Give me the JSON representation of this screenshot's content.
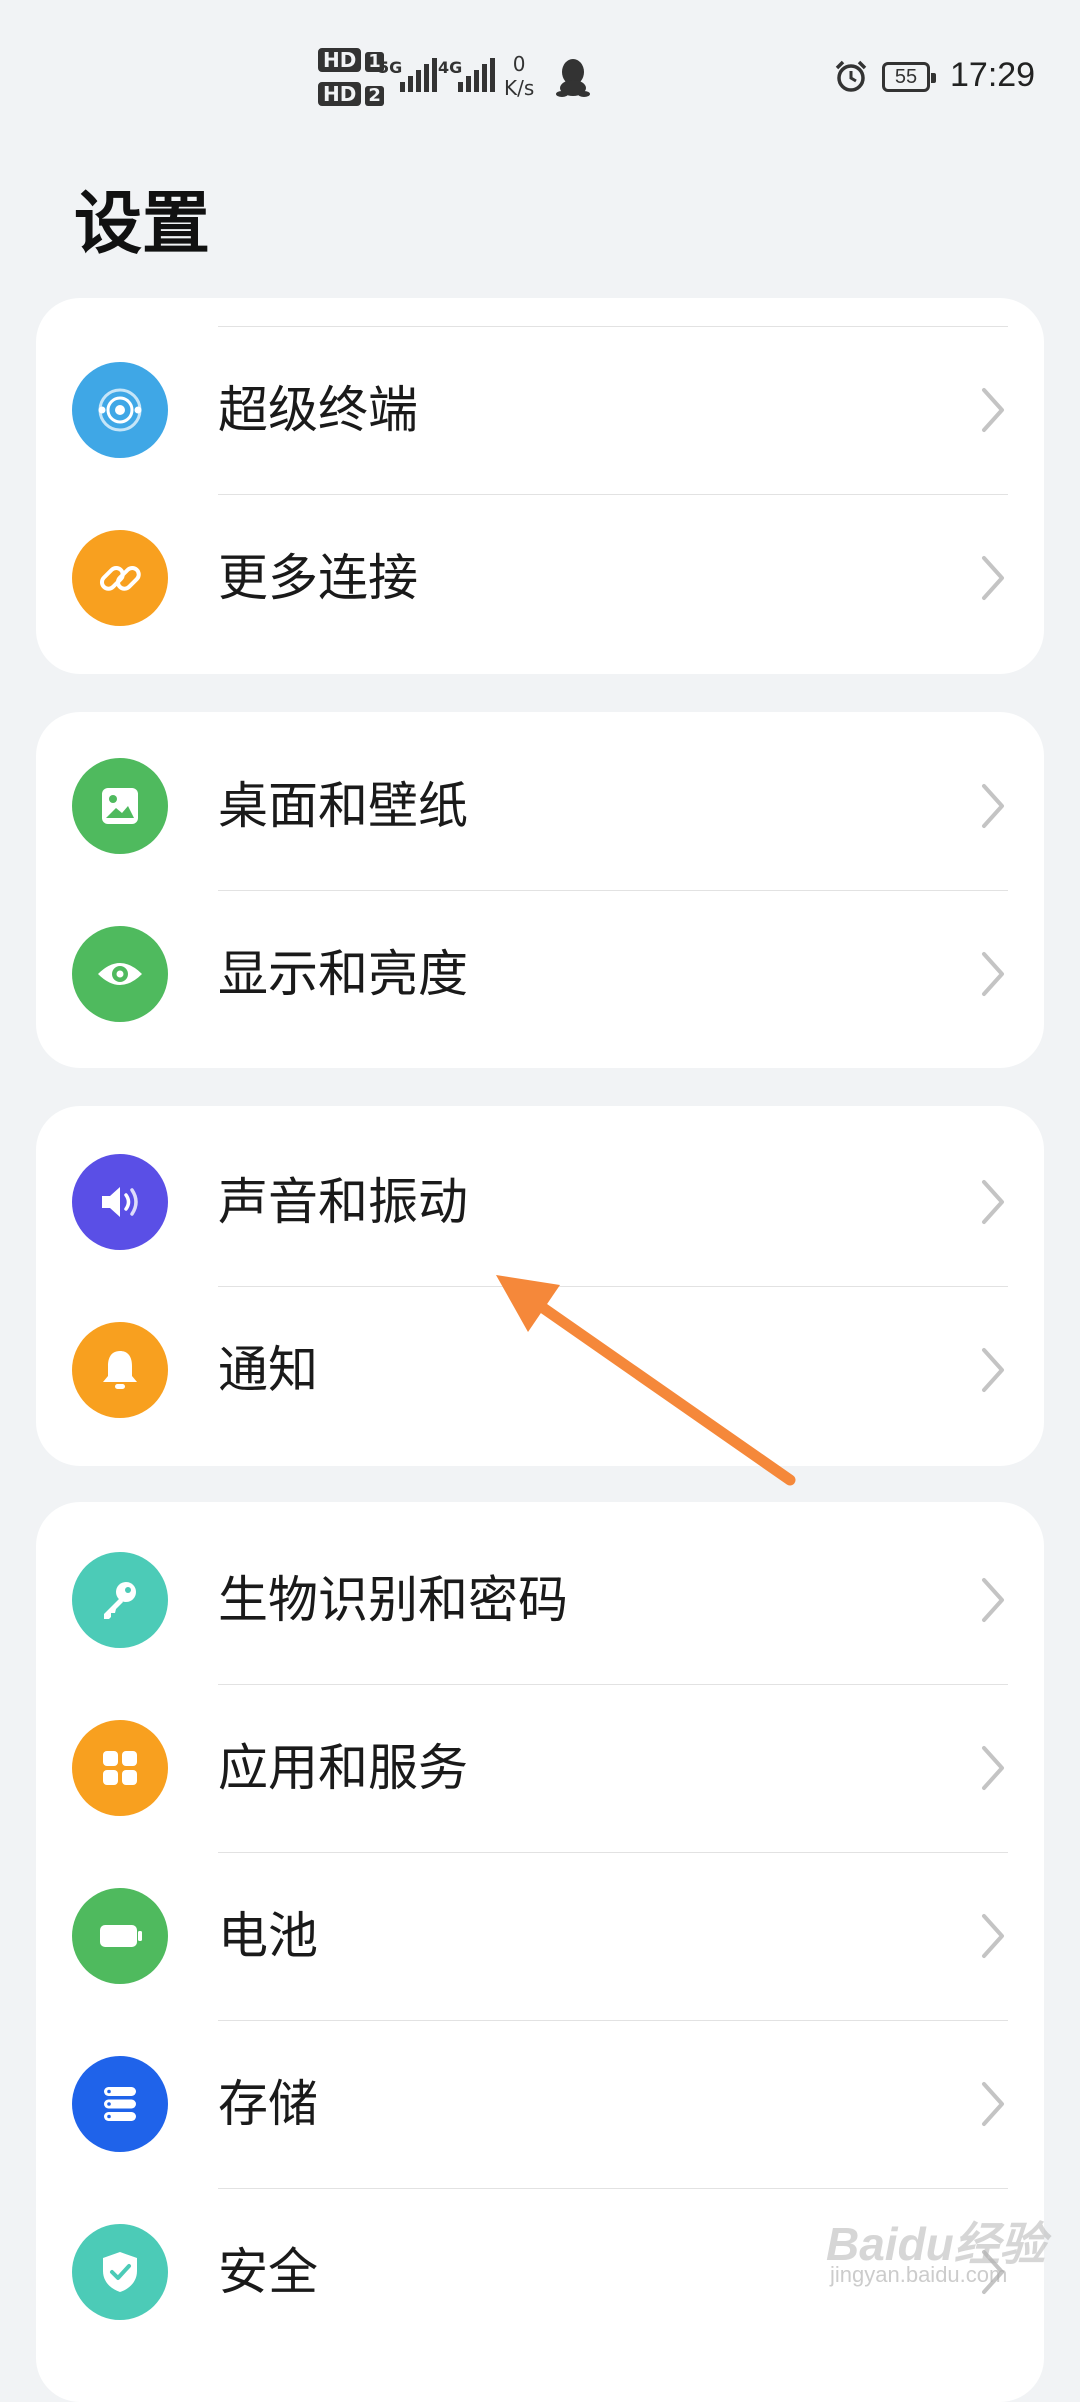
{
  "status_bar": {
    "hd1": "HD",
    "sim1": "1",
    "hd2": "HD",
    "sim2": "2",
    "net1": "5G",
    "net2": "4G",
    "speed_value": "0",
    "speed_unit": "K/s",
    "battery": "55",
    "time": "17:29"
  },
  "title": "设置",
  "groups": [
    {
      "items": [
        {
          "label": "超级终端",
          "icon": "super-device-icon",
          "color": "#3fa7e6"
        },
        {
          "label": "更多连接",
          "icon": "link-icon",
          "color": "#f8a01f"
        }
      ]
    },
    {
      "items": [
        {
          "label": "桌面和壁纸",
          "icon": "wallpaper-icon",
          "color": "#4fba5e"
        },
        {
          "label": "显示和亮度",
          "icon": "eye-icon",
          "color": "#4fba5e"
        }
      ]
    },
    {
      "items": [
        {
          "label": "声音和振动",
          "icon": "sound-icon",
          "color": "#5a4fe6"
        },
        {
          "label": "通知",
          "icon": "bell-icon",
          "color": "#f8a01f"
        }
      ]
    },
    {
      "items": [
        {
          "label": "生物识别和密码",
          "icon": "key-icon",
          "color": "#4ccbb7"
        },
        {
          "label": "应用和服务",
          "icon": "apps-icon",
          "color": "#f8a01f"
        },
        {
          "label": "电池",
          "icon": "battery-icon",
          "color": "#4fba5e"
        },
        {
          "label": "存储",
          "icon": "storage-icon",
          "color": "#1f63ea"
        },
        {
          "label": "安全",
          "icon": "shield-icon",
          "color": "#4ccbb7"
        }
      ]
    }
  ],
  "annotation_color": "#f5883a",
  "watermark": {
    "main": "Baidu经验",
    "sub": "jingyan.baidu.com"
  }
}
